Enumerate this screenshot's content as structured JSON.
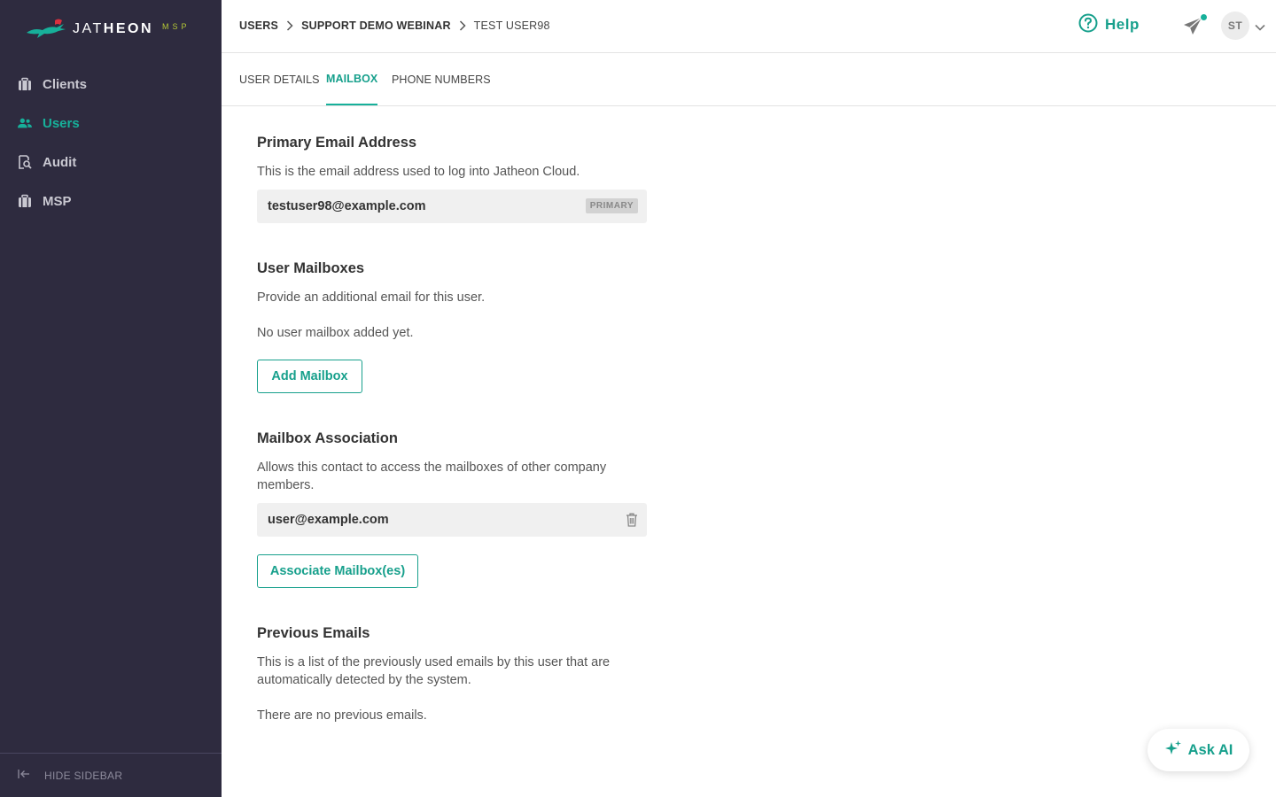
{
  "brand": {
    "name_light": "JAT",
    "name_bold": "HEON",
    "suffix": "MSP"
  },
  "sidebar": {
    "items": [
      {
        "label": "Clients",
        "icon": "briefcase-icon",
        "active": false
      },
      {
        "label": "Users",
        "icon": "users-icon",
        "active": true
      },
      {
        "label": "Audit",
        "icon": "audit-icon",
        "active": false
      },
      {
        "label": "MSP",
        "icon": "briefcase-icon",
        "active": false
      }
    ],
    "hide_label": "HIDE SIDEBAR"
  },
  "breadcrumb": {
    "items": [
      "USERS",
      "SUPPORT DEMO WEBINAR",
      "TEST USER98"
    ]
  },
  "header": {
    "help_label": "Help",
    "avatar_initials": "ST"
  },
  "tabs": {
    "items": [
      {
        "label": "USER DETAILS",
        "active": false
      },
      {
        "label": "MAILBOX",
        "active": true
      },
      {
        "label": "PHONE NUMBERS",
        "active": false
      }
    ]
  },
  "primary_email": {
    "title": "Primary Email Address",
    "description": "This is the email address used to log into Jatheon Cloud.",
    "value": "testuser98@example.com",
    "badge": "PRIMARY"
  },
  "user_mailboxes": {
    "title": "User Mailboxes",
    "description": "Provide an additional email for this user.",
    "empty_text": "No user mailbox added yet.",
    "button_label": "Add Mailbox"
  },
  "mailbox_association": {
    "title": "Mailbox Association",
    "description": "Allows this contact to access the mailboxes of other company members.",
    "items": [
      "user@example.com"
    ],
    "button_label": "Associate Mailbox(es)"
  },
  "previous_emails": {
    "title": "Previous Emails",
    "description": "This is a list of the previously used emails by this user that are automatically detected by the system.",
    "empty_text": "There are no previous emails."
  },
  "ask_ai": {
    "label": "Ask AI"
  },
  "colors": {
    "accent": "#17a08c",
    "sidebar_bg": "#2e2b3f",
    "field_bg": "#f0f0f0"
  }
}
